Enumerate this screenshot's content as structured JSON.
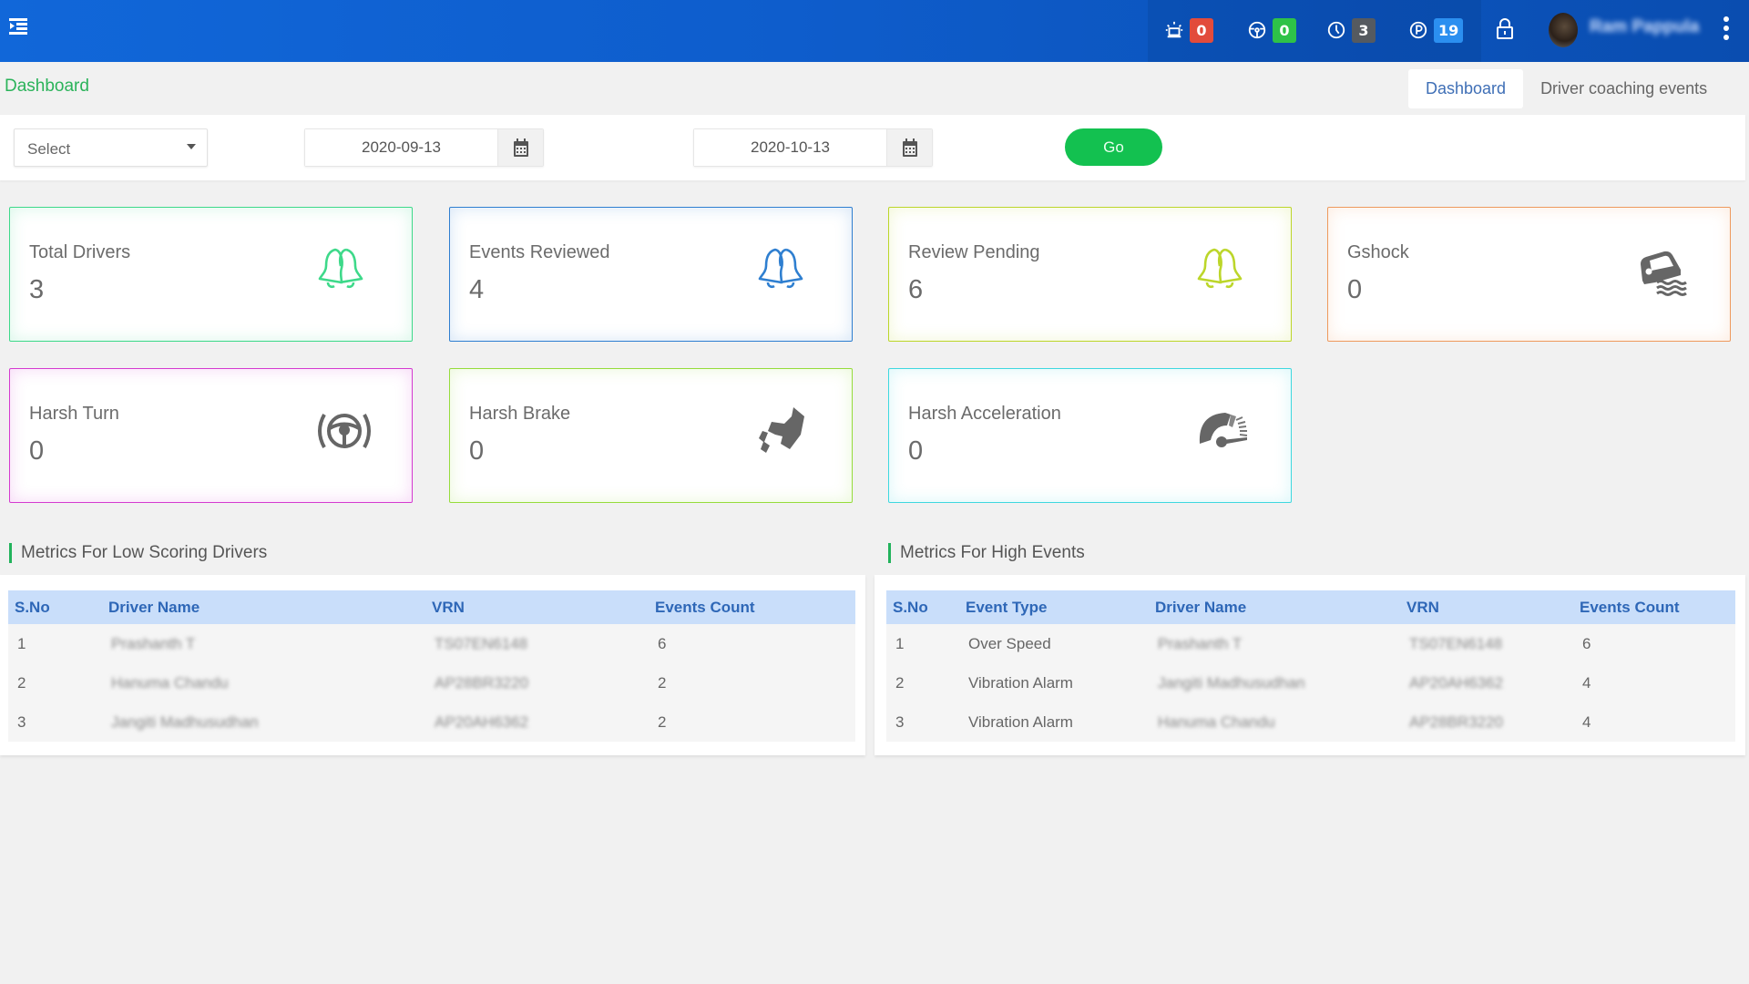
{
  "header": {
    "menu_icon": "menu-toggle-icon",
    "alerts": [
      {
        "icon": "siren-icon",
        "count": "0",
        "color": "#e24b3b"
      },
      {
        "icon": "steering-wheel-icon",
        "count": "0",
        "color": "#2ec248"
      },
      {
        "icon": "clock-icon",
        "count": "3",
        "color": "#555a60"
      },
      {
        "icon": "parking-icon",
        "count": "19",
        "color": "#2b8ff0"
      }
    ],
    "lock_icon": "lock-icon",
    "user_name": "Ram Pappula",
    "more_icon": "more-vertical-icon"
  },
  "breadcrumb": "Dashboard",
  "tabs": [
    {
      "label": "Dashboard",
      "active": true
    },
    {
      "label": "Driver coaching events",
      "active": false
    }
  ],
  "filters": {
    "select": {
      "value": "Select"
    },
    "from_date": "2020-09-13",
    "to_date": "2020-10-13",
    "go_label": "Go"
  },
  "cards": [
    {
      "title": "Total Drivers",
      "value": "3",
      "icon": "bells-icon",
      "color": "#3ed98a"
    },
    {
      "title": "Events Reviewed",
      "value": "4",
      "icon": "bells-icon",
      "color": "#2f7fd0"
    },
    {
      "title": "Review Pending",
      "value": "6",
      "icon": "bells-icon",
      "color": "#bcd62a"
    },
    {
      "title": "Gshock",
      "value": "0",
      "icon": "car-water-icon",
      "color": "#ee9a5e"
    },
    {
      "title": "Harsh Turn",
      "value": "0",
      "icon": "steering-wheel-icon",
      "color": "#d43bd0"
    },
    {
      "title": "Harsh Brake",
      "value": "0",
      "icon": "brake-pedal-icon",
      "color": "#96dc3c"
    },
    {
      "title": "Harsh Acceleration",
      "value": "0",
      "icon": "speedometer-icon",
      "color": "#3fd8df"
    }
  ],
  "low_scoring": {
    "title": "Metrics For Low Scoring Drivers",
    "columns": [
      "S.No",
      "Driver Name",
      "VRN",
      "Events Count"
    ],
    "rows": [
      [
        "1",
        "Prashanth T",
        "TS07EN6148",
        "6"
      ],
      [
        "2",
        "Hanuma Chandu",
        "AP28BR3220",
        "2"
      ],
      [
        "3",
        "Jangiti Madhusudhan",
        "AP20AH6362",
        "2"
      ]
    ]
  },
  "high_events": {
    "title": "Metrics For High Events",
    "columns": [
      "S.No",
      "Event Type",
      "Driver Name",
      "VRN",
      "Events Count"
    ],
    "rows": [
      [
        "1",
        "Over Speed",
        "Prashanth T",
        "TS07EN6148",
        "6"
      ],
      [
        "2",
        "Vibration Alarm",
        "Jangiti Madhusudhan",
        "AP20AH6362",
        "4"
      ],
      [
        "3",
        "Vibration Alarm",
        "Hanuma Chandu",
        "AP28BR3220",
        "4"
      ]
    ]
  }
}
